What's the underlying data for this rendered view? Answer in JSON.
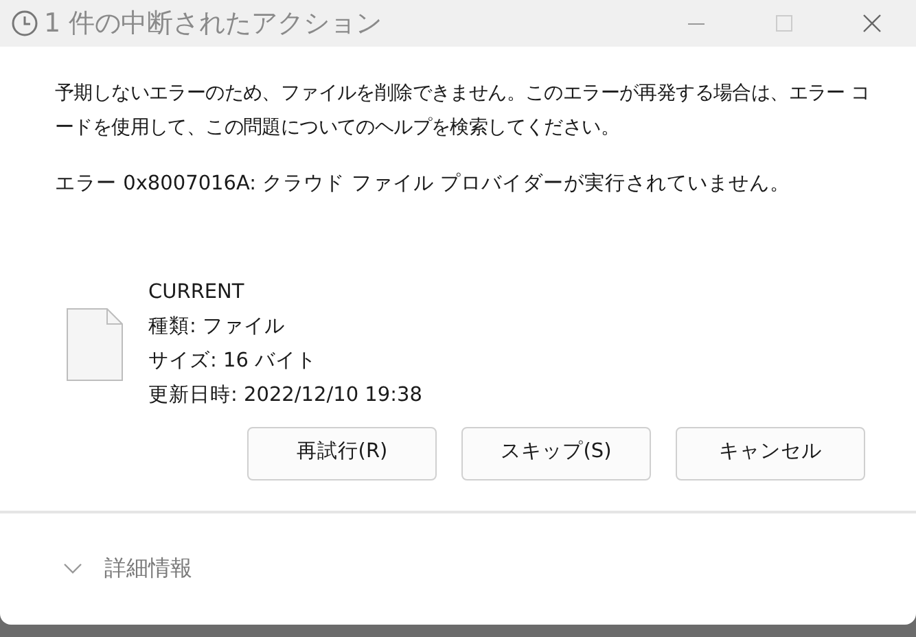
{
  "window": {
    "title": "1 件の中断されたアクション"
  },
  "message": "予期しないエラーのため、ファイルを削除できません。このエラーが再発する場合は、エラー コードを使用して、この問題についてのヘルプを検索してください。",
  "error": "エラー 0x8007016A: クラウド ファイル プロバイダーが実行されていません。",
  "file": {
    "name": "CURRENT",
    "details": [
      "種類: ファイル",
      "サイズ: 16 バイト",
      "更新日時: 2022/12/10 19:38"
    ]
  },
  "buttons": [
    "再試行(R)",
    "スキップ(S)",
    "キャンセル"
  ],
  "details_toggle": {
    "label": "詳細情報",
    "expanded": false
  }
}
